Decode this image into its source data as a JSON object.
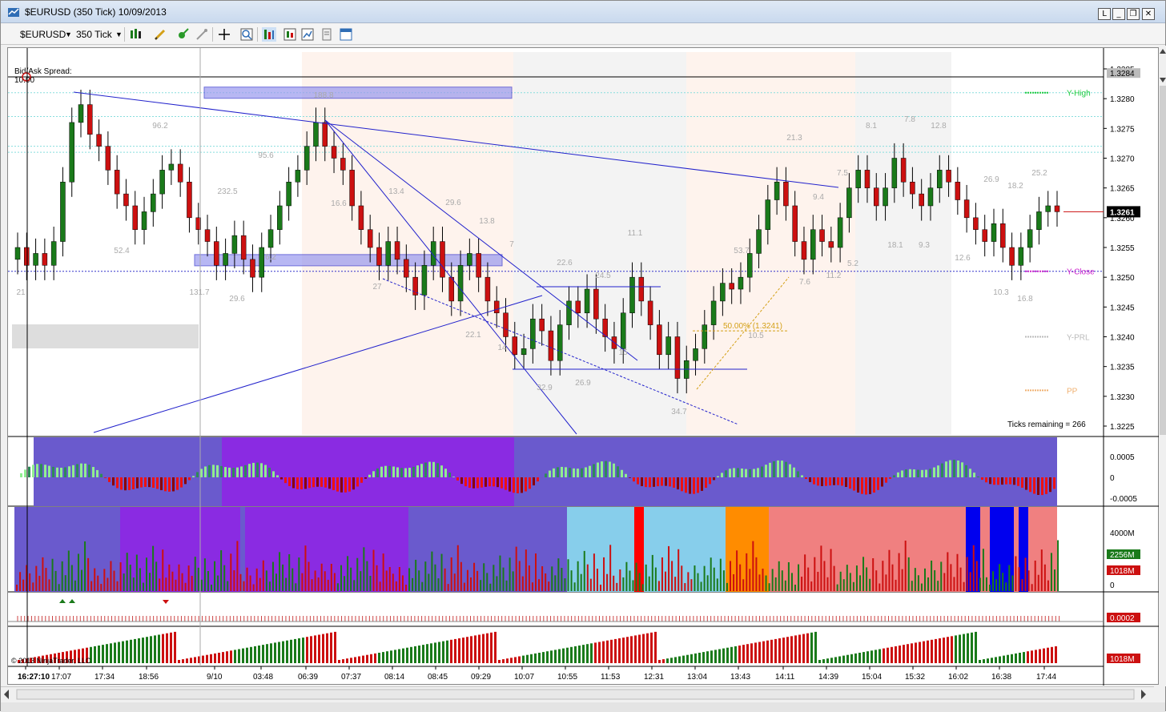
{
  "window": {
    "title": "$EURUSD (350 Tick)  10/09/2013",
    "buttons": {
      "link": "L",
      "minimize": "_",
      "restore": "❐",
      "close": "✕"
    }
  },
  "toolbar": {
    "instrument": "$EURUSD",
    "period": "350 Tick"
  },
  "chart_data": {
    "type": "candlestick",
    "instrument": "$EURUSD",
    "bar_type": "350 Tick",
    "top_left_label": "Bid/Ask Spread:",
    "spread_value": "10.00",
    "ticks_remaining": "Ticks remaining = 266",
    "price_axis": {
      "ticks": [
        "1.3285",
        "1.3280",
        "1.3275",
        "1.3270",
        "1.3265",
        "1.3260",
        "1.3255",
        "1.3250",
        "1.3245",
        "1.3240",
        "1.3235",
        "1.3230",
        "1.3225"
      ],
      "last_price_box": "1.3261",
      "top_box": "1.3284",
      "ylim": [
        1.3222,
        1.3287
      ]
    },
    "levels": [
      {
        "name": "Y-High",
        "price": 1.3281,
        "color": "#22cc44"
      },
      {
        "name": "Y-Close",
        "price": 1.3251,
        "color": "#cc22cc"
      },
      {
        "name": "Y-PRL",
        "price": 1.324,
        "color": "#bbbbbb"
      },
      {
        "name": "PP",
        "price": 1.3231,
        "color": "#f0b070"
      }
    ],
    "fib_label": "50.00% (1.3241)",
    "time_labels": [
      "16:27:10",
      "17:07",
      "17:34",
      "18:56",
      "9/10",
      "03:48",
      "06:39",
      "07:37",
      "08:14",
      "08:45",
      "09:29",
      "10:07",
      "10:55",
      "11:53",
      "12:31",
      "13:04",
      "13:43",
      "14:11",
      "14:39",
      "15:04",
      "15:32",
      "16:02",
      "16:38",
      "17:44"
    ],
    "swing_labels": [
      "96.2",
      "52.4",
      "95.6",
      "232.5",
      "6.2",
      "131.7",
      "29.6",
      "16.6",
      "13.4",
      "29.6",
      "27",
      "13.8",
      "7",
      "22.1",
      "14",
      "22.6",
      "32.9",
      "26.9",
      "24.5",
      "15",
      "11.1",
      "34.7",
      "53.7",
      "10.5",
      "21.3",
      "7.6",
      "11.2",
      "7.5",
      "9.4",
      "5.2",
      "8.1",
      "7.8",
      "12.8",
      "18.1",
      "9.3",
      "12.6",
      "26.9",
      "18.2",
      "25.2",
      "10.3",
      "16.8",
      "21",
      "188.8"
    ],
    "candles_close": [
      1.3255,
      1.3252,
      1.3254,
      1.3252,
      1.3256,
      1.3266,
      1.3276,
      1.3279,
      1.3274,
      1.3272,
      1.3268,
      1.3264,
      1.3262,
      1.3258,
      1.3261,
      1.3264,
      1.3268,
      1.3269,
      1.3266,
      1.326,
      1.3258,
      1.3256,
      1.3252,
      1.3254,
      1.3257,
      1.3253,
      1.325,
      1.3255,
      1.3258,
      1.3262,
      1.3266,
      1.3268,
      1.3272,
      1.3276,
      1.3272,
      1.327,
      1.3268,
      1.3262,
      1.3258,
      1.3255,
      1.3252,
      1.3256,
      1.3253,
      1.325,
      1.3247,
      1.3252,
      1.3256,
      1.325,
      1.3246,
      1.3252,
      1.3254,
      1.325,
      1.3246,
      1.3244,
      1.324,
      1.3237,
      1.3238,
      1.3243,
      1.3241,
      1.3236,
      1.3242,
      1.3246,
      1.3244,
      1.3248,
      1.3243,
      1.324,
      1.3238,
      1.3244,
      1.325,
      1.3246,
      1.3242,
      1.3237,
      1.324,
      1.3233,
      1.3236,
      1.3238,
      1.3242,
      1.3246,
      1.3249,
      1.3248,
      1.325,
      1.3254,
      1.3258,
      1.3263,
      1.3266,
      1.3262,
      1.3256,
      1.3253,
      1.3258,
      1.3256,
      1.3255,
      1.326,
      1.3265,
      1.3268,
      1.3265,
      1.3262,
      1.3265,
      1.327,
      1.3266,
      1.3264,
      1.3262,
      1.3265,
      1.3268,
      1.3266,
      1.3263,
      1.326,
      1.3258,
      1.3256,
      1.3259,
      1.3255,
      1.3252,
      1.3255,
      1.3258,
      1.3261,
      1.3262,
      1.3261
    ],
    "momentum_axis": [
      "0.0005",
      "0",
      "-0.0005"
    ],
    "volume_axis": [
      "4000M",
      "2256M",
      "1018M",
      "0"
    ],
    "tick_axis_box": "0.0002",
    "volume2_box": "1018M"
  },
  "copyright": "© 2013 NinjaTrader, LLC",
  "colors": {
    "up": "#1a7a1a",
    "down": "#cc1010",
    "trend": "#2222cc",
    "zone_blue": "#6a5acd",
    "zone_purple": "#8a2be2",
    "zone_lightblue": "#87ceeb",
    "zone_salmon": "#f08080",
    "zone_orange": "#ff8c00"
  }
}
